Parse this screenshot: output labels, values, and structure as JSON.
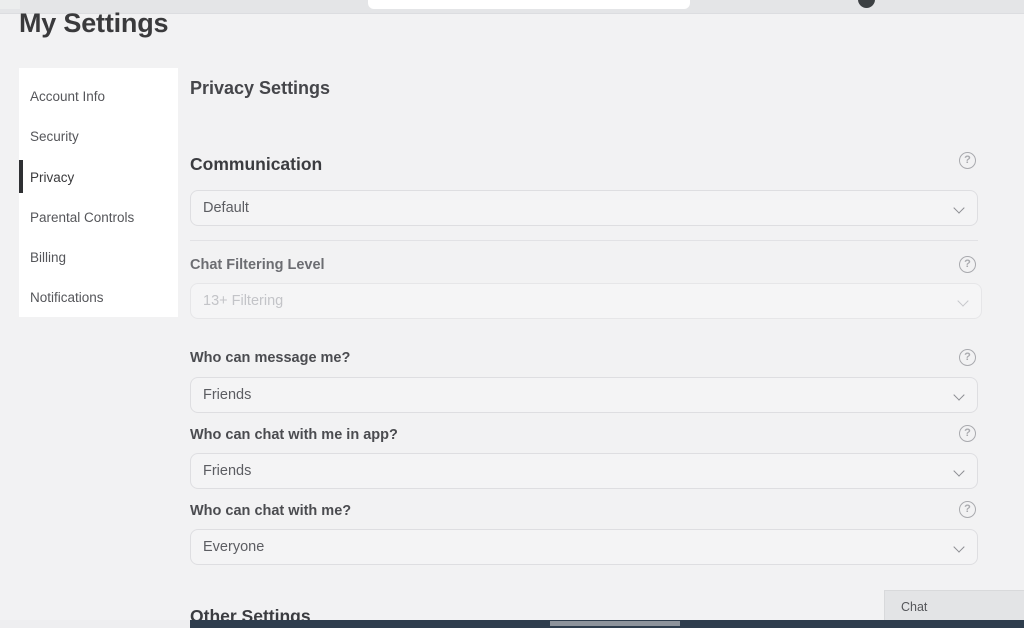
{
  "browser": {
    "omnibox_present": true,
    "avatar_icon": "avatar-icon"
  },
  "page": {
    "title": "My Settings"
  },
  "sidebar": {
    "items": [
      {
        "label": "Account Info",
        "active": false
      },
      {
        "label": "Security",
        "active": false
      },
      {
        "label": "Privacy",
        "active": true
      },
      {
        "label": "Parental Controls",
        "active": false
      },
      {
        "label": "Billing",
        "active": false
      },
      {
        "label": "Notifications",
        "active": false
      }
    ]
  },
  "main": {
    "section_title": "Privacy Settings",
    "group_heading": "Communication",
    "other_settings_heading": "Other Settings",
    "help_icon": "help-circle-icon",
    "chevron_icon": "chevron-down-icon",
    "fields": [
      {
        "label": "",
        "value": "Default",
        "disabled": false
      },
      {
        "label": "Chat Filtering Level",
        "value": "13+ Filtering",
        "disabled": true
      },
      {
        "label": "Who can message me?",
        "value": "Friends",
        "disabled": false
      },
      {
        "label": "Who can chat with me in app?",
        "value": "Friends",
        "disabled": false
      },
      {
        "label": "Who can chat with me?",
        "value": "Everyone",
        "disabled": false
      }
    ]
  },
  "chat_widget": {
    "label": "Chat"
  },
  "colors": {
    "page_background": "#f2f2f3",
    "card_background": "#ffffff",
    "active_indicator": "#2f3033",
    "text_primary": "#3a3a3c",
    "text_secondary": "#5c5d62",
    "text_disabled": "#c3c4c8",
    "field_background": "#f4f4f5",
    "field_border": "#dedee1",
    "bottom_bar": "#2e3d4d"
  }
}
